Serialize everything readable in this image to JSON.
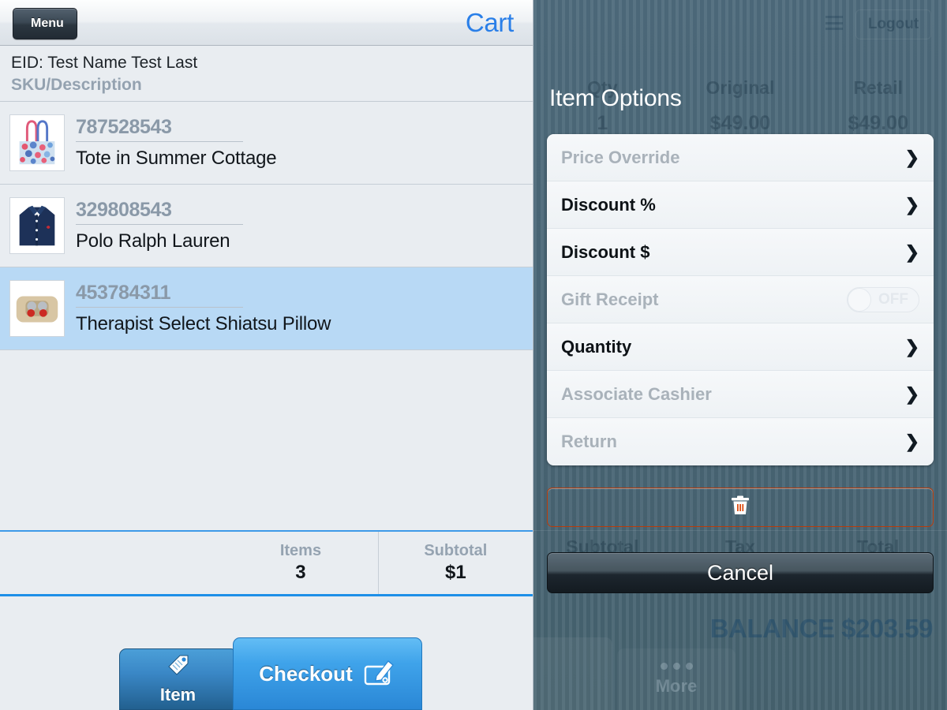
{
  "header": {
    "menu_label": "Menu",
    "title": "Cart"
  },
  "cart": {
    "eid_line": "EID: Test Name Test Last",
    "column_header": "SKU/Description",
    "items": [
      {
        "sku": "787528543",
        "description": "Tote in Summer Cottage",
        "thumb": "tote-bag-thumbnail",
        "selected": false
      },
      {
        "sku": "329808543",
        "description": "Polo Ralph Lauren",
        "thumb": "polo-shirt-thumbnail",
        "selected": false
      },
      {
        "sku": "453784311",
        "description": "Therapist Select Shiatsu Pillow",
        "thumb": "shiatsu-pillow-thumbnail",
        "selected": true
      }
    ]
  },
  "totals": {
    "items_label": "Items",
    "items_value": "3",
    "subtotal_label": "Subtotal",
    "subtotal_value": "$1"
  },
  "toolbar": {
    "item_label": "Item",
    "item_icon": "price-tag-icon",
    "checkout_label": "Checkout",
    "checkout_icon": "signature-pad-icon"
  },
  "background": {
    "logout_label": "Logout",
    "menu_icon": "hamburger-icon",
    "columns": [
      "Qty",
      "Original",
      "Retail"
    ],
    "row_values": [
      "1",
      "$49.00",
      "$49.00"
    ],
    "totals_columns": [
      "Subtotal",
      "Tax",
      "Total"
    ],
    "totals_values": [
      "",
      "",
      ""
    ],
    "balance": "BALANCE $203.59",
    "more_label": "More",
    "more_icon": "ellipsis-icon"
  },
  "modal": {
    "title": "Item Options",
    "options": [
      {
        "label": "Price Override",
        "type": "chevron",
        "disabled": true,
        "icon": "chevron-right-icon"
      },
      {
        "label": "Discount %",
        "type": "chevron",
        "disabled": false,
        "icon": "chevron-right-icon"
      },
      {
        "label": "Discount $",
        "type": "chevron",
        "disabled": false,
        "icon": "chevron-right-icon"
      },
      {
        "label": "Gift Receipt",
        "type": "toggle",
        "disabled": true,
        "toggle_state": "OFF"
      },
      {
        "label": "Quantity",
        "type": "chevron",
        "disabled": false,
        "icon": "chevron-right-icon"
      },
      {
        "label": "Associate Cashier",
        "type": "chevron",
        "disabled": true,
        "icon": "chevron-right-icon"
      },
      {
        "label": "Return",
        "type": "chevron",
        "disabled": true,
        "icon": "chevron-right-icon"
      }
    ],
    "delete_icon": "trash-icon",
    "cancel_label": "Cancel"
  },
  "colors": {
    "accent_blue": "#2a7fe8",
    "selected_row": "#b8d9f5",
    "panel_bg": "#e9edf1",
    "overlay_slate": "#4a6777",
    "delete_orange": "#de4d12",
    "muted_label": "#94a2b0"
  }
}
